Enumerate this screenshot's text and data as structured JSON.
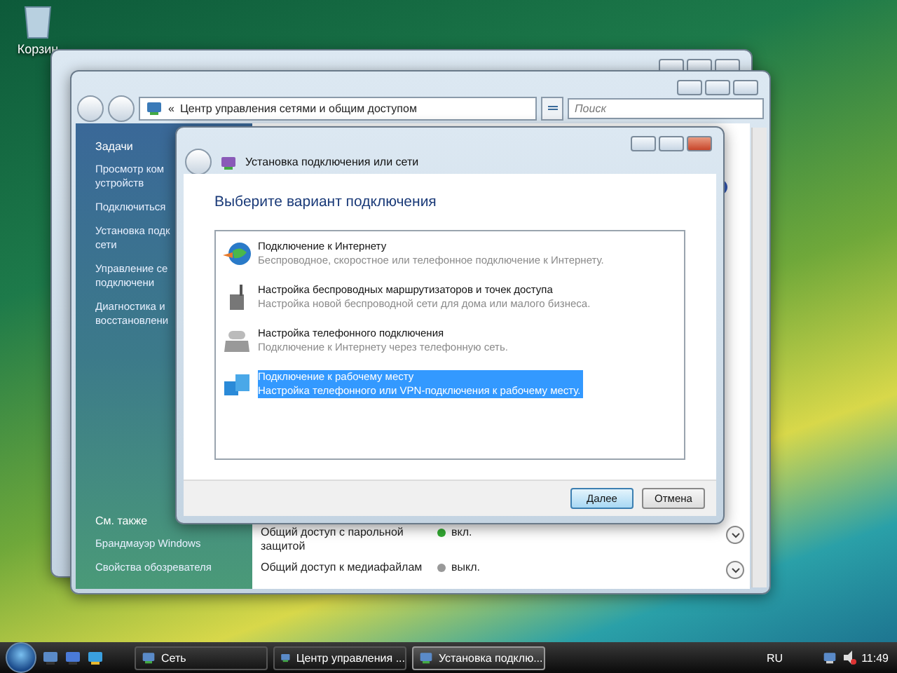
{
  "desktop": {
    "icons": [
      {
        "label": "Корзин"
      }
    ]
  },
  "network_window": {
    "breadcrumb_mark": "«",
    "address": "Центр управления сетями и общим доступом",
    "search": {
      "placeholder": "Поиск"
    },
    "sidebar": {
      "heading": "Задачи",
      "items": [
        {
          "lines": [
            "Просмотр ком",
            "устройств"
          ]
        },
        {
          "lines": [
            "Подключиться"
          ]
        },
        {
          "lines": [
            "Установка подк",
            "сети"
          ]
        },
        {
          "lines": [
            "Управление се",
            "подключени"
          ]
        },
        {
          "lines": [
            "Диагностика и",
            "восстановлени"
          ]
        }
      ],
      "see_also": {
        "heading": "См. также",
        "items": [
          "Брандмауэр Windows",
          "Свойства обозревателя"
        ]
      }
    },
    "sharing": [
      {
        "name": "Общий доступ с парольной защитой",
        "status": "вкл.",
        "on": true
      },
      {
        "name": "Общий доступ к медиафайлам",
        "status": "выкл.",
        "on": false
      }
    ]
  },
  "dialog": {
    "title": "Установка подключения или сети",
    "heading": "Выберите вариант подключения",
    "options": [
      {
        "kind": "internet",
        "title": "Подключение к Интернету",
        "description": "Беспроводное, скоростное или телефонное подключение к Интернету.",
        "selected": false
      },
      {
        "kind": "router",
        "title": "Настройка беспроводных маршрутизаторов и точек доступа",
        "description": "Настройка новой беспроводной сети для дома или малого бизнеса.",
        "selected": false
      },
      {
        "kind": "phone",
        "title": "Настройка телефонного подключения",
        "description": "Подключение к Интернету через телефонную сеть.",
        "selected": false
      },
      {
        "kind": "workplace",
        "title": "Подключение к рабочему месту",
        "description": "Настройка телефонного или VPN-подключения к рабочему месту.",
        "selected": true
      }
    ],
    "buttons": [
      "Далее",
      "Отмена"
    ]
  },
  "taskbar": {
    "buttons": [
      {
        "label": "Сеть",
        "selected": false
      },
      {
        "label": "Центр управления ...",
        "selected": false
      },
      {
        "label": "Установка подклю...",
        "selected": true
      }
    ],
    "language": "RU",
    "time": "11:49"
  }
}
